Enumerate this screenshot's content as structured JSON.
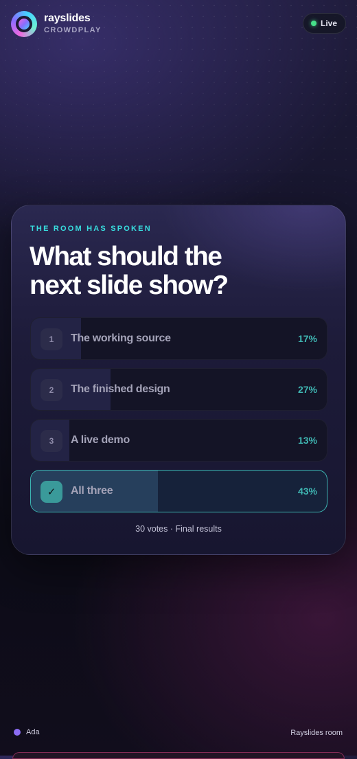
{
  "header": {
    "brand_name": "rayslides",
    "brand_sub": "CROWDPLAY",
    "live_label": "Live"
  },
  "poll": {
    "eyebrow": "THE ROOM HAS SPOKEN",
    "question_line1": "What should the",
    "question_line2": "next slide show?",
    "options": [
      {
        "number": "1",
        "label": "The working source",
        "percent_text": "17%",
        "share": 0.17
      },
      {
        "number": "2",
        "label": "The finished design",
        "percent_text": "27%",
        "share": 0.27
      },
      {
        "number": "3",
        "label": "A live demo",
        "percent_text": "13%",
        "share": 0.13
      },
      {
        "number": "✓",
        "label": "All three",
        "percent_text": "43%",
        "share": 0.43,
        "selected": true
      }
    ],
    "footer": "30 votes · Final results"
  },
  "footer": {
    "user_name": "Ada",
    "room_name": "Rayslides room"
  },
  "colors": {
    "accent_teal": "#3fb6b2",
    "eyebrow_cyan": "#38dfe0",
    "live_green": "#46e08a",
    "user_purple": "#8b6cf4"
  }
}
